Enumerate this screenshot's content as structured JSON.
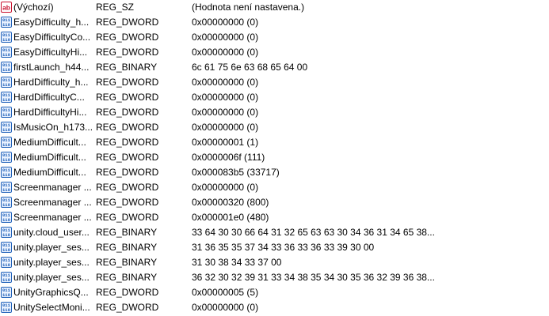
{
  "registry_values": [
    {
      "icon": "string-value-icon",
      "name": "(Výchozí)",
      "type": "REG_SZ",
      "data": "(Hodnota není nastavena.)"
    },
    {
      "icon": "binary-value-icon",
      "name": "EasyDifficulty_h...",
      "type": "REG_DWORD",
      "data": "0x00000000 (0)"
    },
    {
      "icon": "binary-value-icon",
      "name": "EasyDifficultyCo...",
      "type": "REG_DWORD",
      "data": "0x00000000 (0)"
    },
    {
      "icon": "binary-value-icon",
      "name": "EasyDifficultyHi...",
      "type": "REG_DWORD",
      "data": "0x00000000 (0)"
    },
    {
      "icon": "binary-value-icon",
      "name": "firstLaunch_h44...",
      "type": "REG_BINARY",
      "data": "6c 61 75 6e 63 68 65 64 00"
    },
    {
      "icon": "binary-value-icon",
      "name": "HardDifficulty_h...",
      "type": "REG_DWORD",
      "data": "0x00000000 (0)"
    },
    {
      "icon": "binary-value-icon",
      "name": "HardDifficultyC...",
      "type": "REG_DWORD",
      "data": "0x00000000 (0)"
    },
    {
      "icon": "binary-value-icon",
      "name": "HardDifficultyHi...",
      "type": "REG_DWORD",
      "data": "0x00000000 (0)"
    },
    {
      "icon": "binary-value-icon",
      "name": "IsMusicOn_h173...",
      "type": "REG_DWORD",
      "data": "0x00000000 (0)"
    },
    {
      "icon": "binary-value-icon",
      "name": "MediumDifficult...",
      "type": "REG_DWORD",
      "data": "0x00000001 (1)"
    },
    {
      "icon": "binary-value-icon",
      "name": "MediumDifficult...",
      "type": "REG_DWORD",
      "data": "0x0000006f (111)"
    },
    {
      "icon": "binary-value-icon",
      "name": "MediumDifficult...",
      "type": "REG_DWORD",
      "data": "0x000083b5 (33717)"
    },
    {
      "icon": "binary-value-icon",
      "name": "Screenmanager ...",
      "type": "REG_DWORD",
      "data": "0x00000000 (0)"
    },
    {
      "icon": "binary-value-icon",
      "name": "Screenmanager ...",
      "type": "REG_DWORD",
      "data": "0x00000320 (800)"
    },
    {
      "icon": "binary-value-icon",
      "name": "Screenmanager ...",
      "type": "REG_DWORD",
      "data": "0x000001e0 (480)"
    },
    {
      "icon": "binary-value-icon",
      "name": "unity.cloud_user...",
      "type": "REG_BINARY",
      "data": "33 64 30 30 66 64 31 32 65 63 63 30 34 36 31 34 65 38..."
    },
    {
      "icon": "binary-value-icon",
      "name": "unity.player_ses...",
      "type": "REG_BINARY",
      "data": "31 36 35 35 37 34 33 36 33 36 33 39 30 00"
    },
    {
      "icon": "binary-value-icon",
      "name": "unity.player_ses...",
      "type": "REG_BINARY",
      "data": "31 30 38 34 33 37 00"
    },
    {
      "icon": "binary-value-icon",
      "name": "unity.player_ses...",
      "type": "REG_BINARY",
      "data": "36 32 30 32 39 31 33 34 38 35 34 30 35 36 32 39 36 38..."
    },
    {
      "icon": "binary-value-icon",
      "name": "UnityGraphicsQ...",
      "type": "REG_DWORD",
      "data": "0x00000005 (5)"
    },
    {
      "icon": "binary-value-icon",
      "name": "UnitySelectMoni...",
      "type": "REG_DWORD",
      "data": "0x00000000 (0)"
    }
  ],
  "colors": {
    "string_icon_red": "#c8102e",
    "binary_icon_blue": "#1d5fb8",
    "binary_icon_bg": "#eaf2ff"
  }
}
